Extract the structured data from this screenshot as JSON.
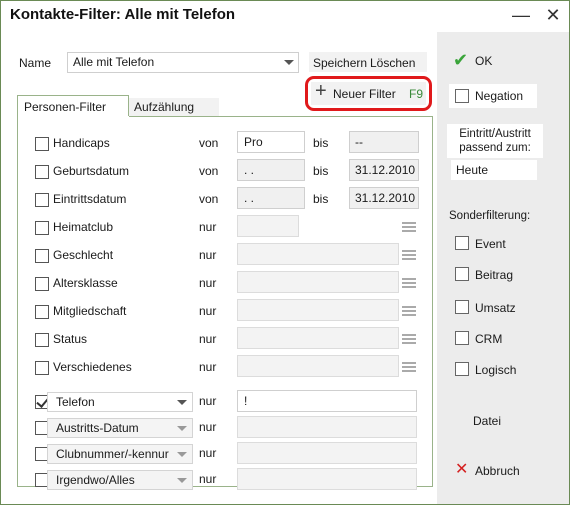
{
  "window": {
    "title": "Kontakte-Filter: Alle mit Telefon"
  },
  "header": {
    "name_label": "Name",
    "name_value": "Alle mit Telefon",
    "save_label": "Speichern",
    "delete_label": "Löschen",
    "new_filter_label": "Neuer Filter",
    "new_filter_shortcut": "F9",
    "highlight_color": "#e0191b"
  },
  "tabs": [
    {
      "label": "Personen-Filter"
    },
    {
      "label": "Aufzählung"
    }
  ],
  "rows": [
    {
      "label": "Handicaps",
      "op": "von",
      "val": "Pro",
      "to": "bis",
      "val2": "--",
      "checked": false
    },
    {
      "label": "Geburtsdatum",
      "op": "von",
      "val": "  .  .",
      "to": "bis",
      "val2": "31.12.2010",
      "checked": false
    },
    {
      "label": "Eintrittsdatum",
      "op": "von",
      "val": "  .  .",
      "to": "bis",
      "val2": "31.12.2010",
      "checked": false
    },
    {
      "label": "Heimatclub",
      "op": "nur",
      "val": "",
      "checked": false
    },
    {
      "label": "Geschlecht",
      "op": "nur",
      "val": "",
      "checked": false
    },
    {
      "label": "Altersklasse",
      "op": "nur",
      "val": "",
      "checked": false
    },
    {
      "label": "Mitgliedschaft",
      "op": "nur",
      "val": "",
      "checked": false
    },
    {
      "label": "Status",
      "op": "nur",
      "val": "",
      "checked": false
    },
    {
      "label": "Verschiedenes",
      "op": "nur",
      "val": "",
      "checked": false
    }
  ],
  "combo_rows": [
    {
      "label": "Telefon",
      "op": "nur",
      "val": "!",
      "checked": true
    },
    {
      "label": "Austritts-Datum",
      "op": "nur",
      "val": "",
      "checked": false
    },
    {
      "label": "Clubnummer/-kennur",
      "op": "nur",
      "val": "",
      "checked": false
    },
    {
      "label": "Irgendwo/Alles",
      "op": "nur",
      "val": "",
      "checked": false
    }
  ],
  "right": {
    "ok_label": "OK",
    "negation_label": "Negation",
    "date_caption": "Eintritt/Austritt passend zum:",
    "date_value": "Heute",
    "special_label": "Sonderfilterung:",
    "special": [
      {
        "label": "Event"
      },
      {
        "label": "Beitrag"
      },
      {
        "label": "Umsatz"
      },
      {
        "label": "CRM"
      },
      {
        "label": "Logisch"
      }
    ],
    "file_label": "Datei",
    "cancel_label": "Abbruch",
    "ok_color": "#3aa43a",
    "cancel_color": "#d42020"
  }
}
